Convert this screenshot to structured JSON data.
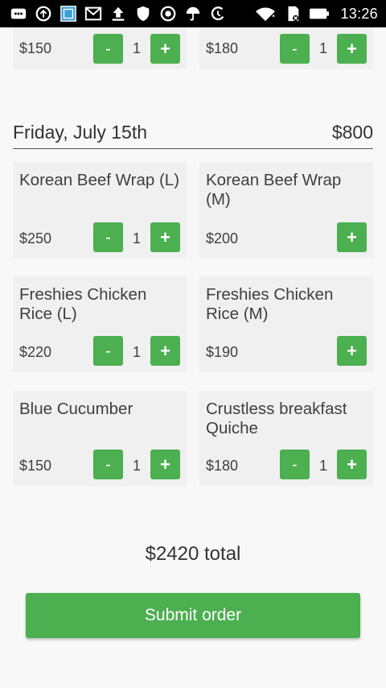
{
  "status_bar": {
    "time": "13:26",
    "icons": [
      "chat-icon",
      "sync-icon",
      "screenshot-icon",
      "gmail-icon",
      "upload-icon",
      "shield-icon",
      "target-icon",
      "umbrella-icon",
      "data-saver-icon",
      "wifi-icon",
      "sd-card-icon",
      "battery-icon"
    ]
  },
  "top_row": {
    "left": {
      "price": "$150",
      "qty": "1",
      "minus": "-",
      "plus": "+"
    },
    "right": {
      "price": "$180",
      "qty": "1",
      "minus": "-",
      "plus": "+"
    }
  },
  "day": {
    "title": "Friday, July 15th",
    "total": "$800",
    "items": [
      {
        "name": "Korean Beef Wrap (L)",
        "price": "$250",
        "qty": "1",
        "minus": "-",
        "plus": "+"
      },
      {
        "name": "Korean Beef Wrap (M)",
        "price": "$200",
        "plus": "+"
      },
      {
        "name": "Freshies Chicken Rice (L)",
        "price": "$220",
        "qty": "1",
        "minus": "-",
        "plus": "+"
      },
      {
        "name": "Freshies Chicken Rice (M)",
        "price": "$190",
        "plus": "+"
      },
      {
        "name": "Blue Cucumber",
        "price": "$150",
        "qty": "1",
        "minus": "-",
        "plus": "+"
      },
      {
        "name": "Crustless breakfast Quiche",
        "price": "$180",
        "qty": "1",
        "minus": "-",
        "plus": "+"
      }
    ]
  },
  "footer": {
    "total": "$2420 total",
    "submit_label": "Submit order"
  },
  "colors": {
    "accent": "#4caf50",
    "card_bg": "#f0f0f0",
    "page_bg": "#f8f8f8"
  }
}
